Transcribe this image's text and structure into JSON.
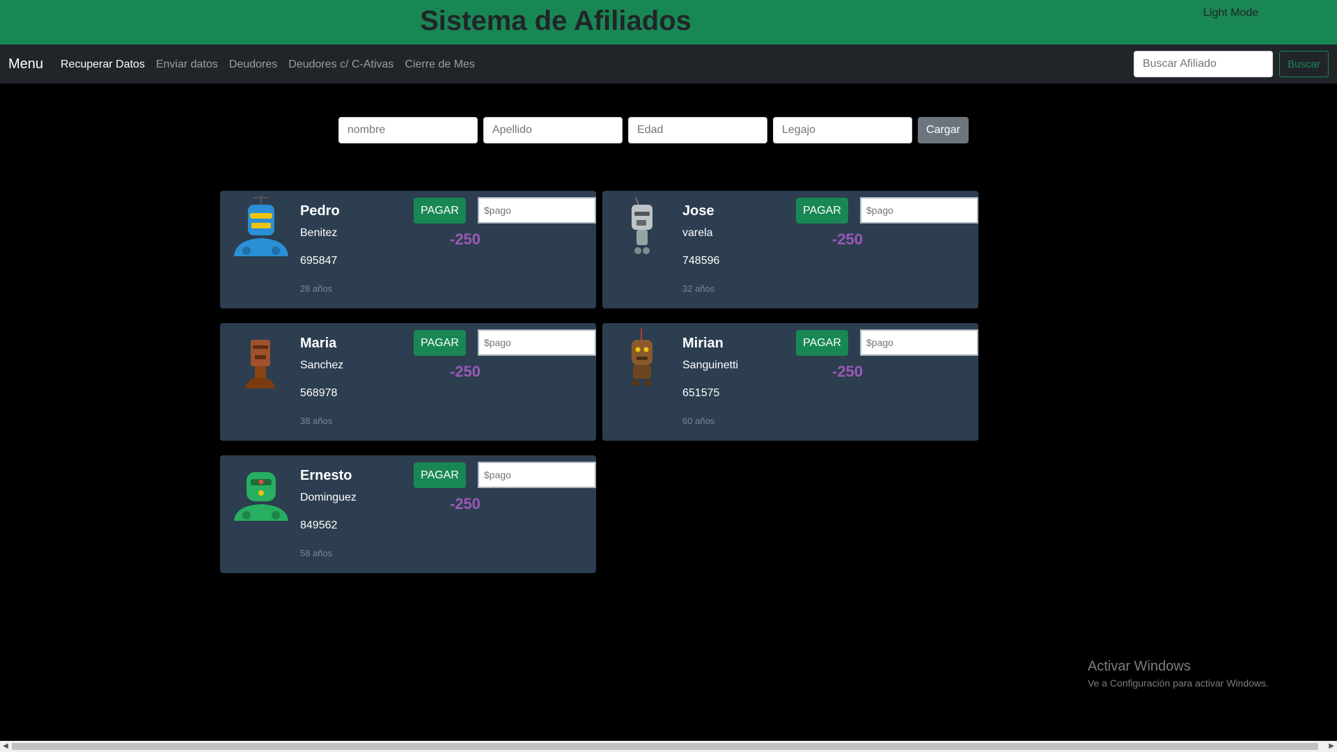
{
  "header": {
    "title": "Sistema de Afiliados",
    "mode_toggle": "Light Mode"
  },
  "navbar": {
    "brand": "Menu",
    "links": [
      "Recuperar Datos",
      "Enviar datos",
      "Deudores",
      "Deudores c/ C-Ativas",
      "Cierre de Mes"
    ],
    "search_placeholder": "Buscar Afiliado",
    "search_button": "Buscar"
  },
  "form": {
    "nombre_placeholder": "nombre",
    "apellido_placeholder": "Apellido",
    "edad_placeholder": "Edad",
    "legajo_placeholder": "Legajo",
    "submit_label": "Cargar"
  },
  "cards": [
    {
      "name": "Pedro",
      "lastname": "Benitez",
      "legajo": "695847",
      "age": "28 años",
      "pay_label": "PAGAR",
      "pay_placeholder": "$pago",
      "balance": "-250",
      "avatar_icon": "robot-blue-icon"
    },
    {
      "name": "Jose",
      "lastname": "varela",
      "legajo": "748596",
      "age": "32 años",
      "pay_label": "PAGAR",
      "pay_placeholder": "$pago",
      "balance": "-250",
      "avatar_icon": "robot-gray-icon"
    },
    {
      "name": "Maria",
      "lastname": "Sanchez",
      "legajo": "568978",
      "age": "38 años",
      "pay_label": "PAGAR",
      "pay_placeholder": "$pago",
      "balance": "-250",
      "avatar_icon": "robot-brown-icon"
    },
    {
      "name": "Mirian",
      "lastname": "Sanguinetti",
      "legajo": "651575",
      "age": "60 años",
      "pay_label": "PAGAR",
      "pay_placeholder": "$pago",
      "balance": "-250",
      "avatar_icon": "robot-bronze-icon"
    },
    {
      "name": "Ernesto",
      "lastname": "Dominguez",
      "legajo": "849562",
      "age": "58 años",
      "pay_label": "PAGAR",
      "pay_placeholder": "$pago",
      "balance": "-250",
      "avatar_icon": "robot-green-icon"
    }
  ],
  "watermark": {
    "title": "Activar Windows",
    "subtitle": "Ve a Configuración para activar Windows."
  },
  "colors": {
    "header_bg": "#198754",
    "navbar_bg": "#212529",
    "card_bg": "#2c3e50",
    "balance": "#9b59b6",
    "button_green": "#198754"
  }
}
